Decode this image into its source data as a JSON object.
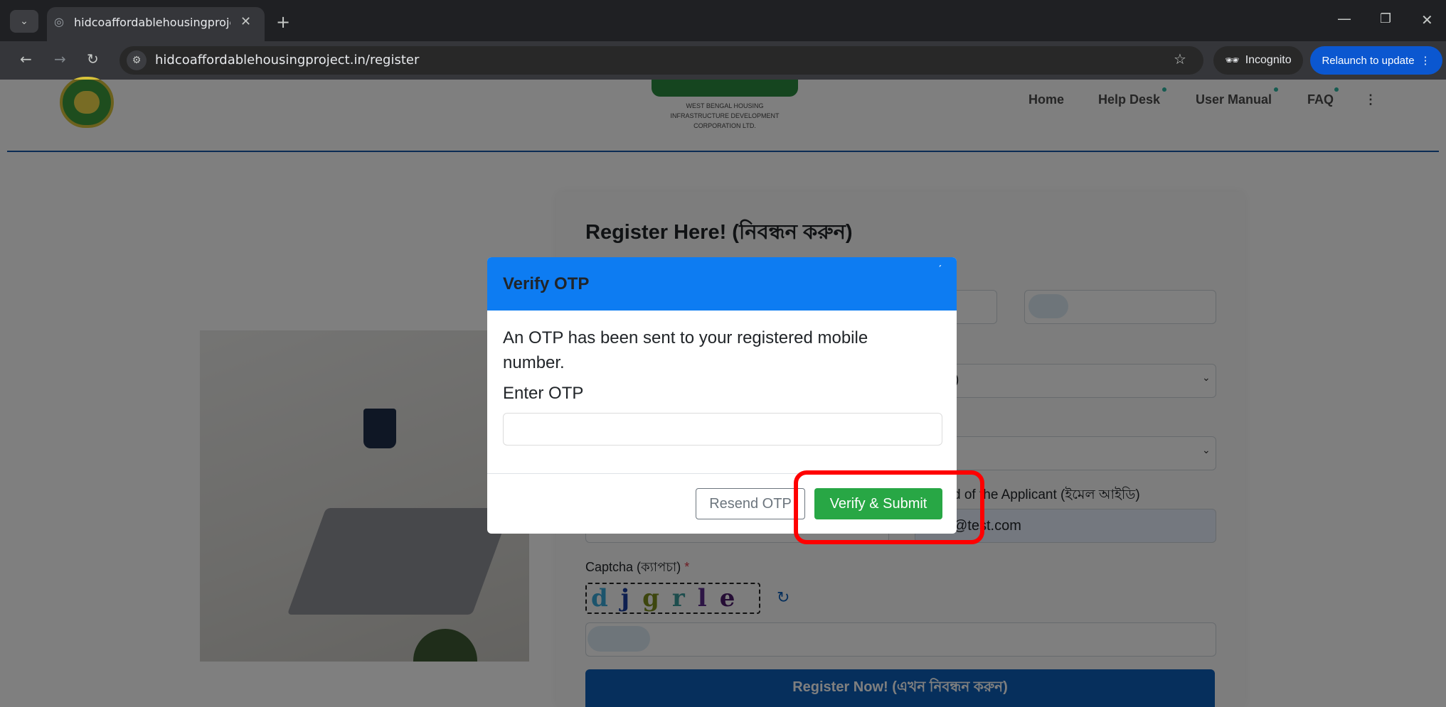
{
  "browser": {
    "tab_title": "hidcoaffordablehousingproject.",
    "url": "hidcoaffordablehousingproject.in/register",
    "incognito_label": "Incognito",
    "relaunch_label": "Relaunch to update"
  },
  "header": {
    "org_line1": "WEST BENGAL HOUSING",
    "org_line2": "INFRASTRUCTURE DEVELOPMENT",
    "org_line3": "CORPORATION LTD.",
    "nav": {
      "home": "Home",
      "help_desk": "Help Desk",
      "user_manual": "User Manual",
      "faq": "FAQ",
      "more": "⋮"
    }
  },
  "form": {
    "title": "Register Here! (নিবন্ধন করুন)",
    "select1_value": ")",
    "email_label": "d of the Applicant (ইমেল আইডি)",
    "email_value": "@test.com",
    "captcha_label": "Captcha (ক্যাপচা)",
    "required_mark": "*",
    "captcha_chars": [
      "d",
      "j",
      "g",
      "r",
      "l",
      "e"
    ],
    "register_button": "Register Now! (এখন নিবন্ধন করুন)"
  },
  "modal": {
    "title": "Verify OTP",
    "close": "ˊ",
    "message": "An OTP has been sent to your registered mobile number.",
    "otp_label": "Enter OTP",
    "otp_value": "",
    "resend_button": "Resend OTP",
    "verify_button": "Verify & Submit"
  },
  "colors": {
    "modal_header": "#0d7cf2",
    "verify_button": "#28a745",
    "highlight": "#ff0000",
    "register_button": "#0d5fb8"
  }
}
